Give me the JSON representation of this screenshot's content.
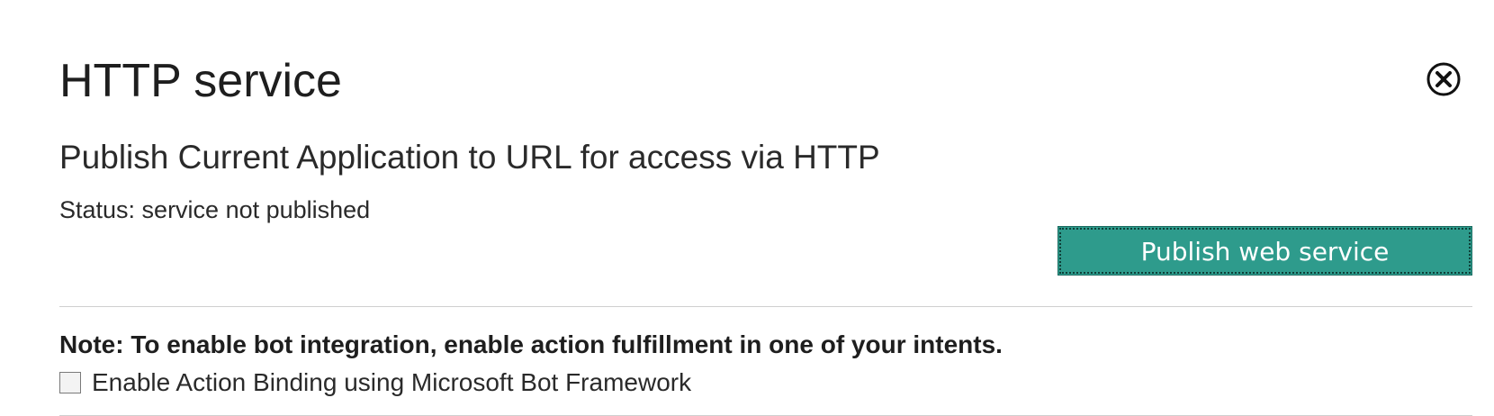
{
  "dialog": {
    "title": "HTTP service",
    "close_icon": "close-circle-icon"
  },
  "publish": {
    "subtitle": "Publish Current Application to URL for access via HTTP",
    "status_text": "Status: service not published",
    "button_label": "Publish web service",
    "button_color": "#2e9b8c"
  },
  "bot": {
    "note": "Note: To enable bot integration, enable action fulfillment in one of your intents.",
    "checkbox_label": "Enable Action Binding using Microsoft Bot Framework",
    "checkbox_checked": false
  }
}
